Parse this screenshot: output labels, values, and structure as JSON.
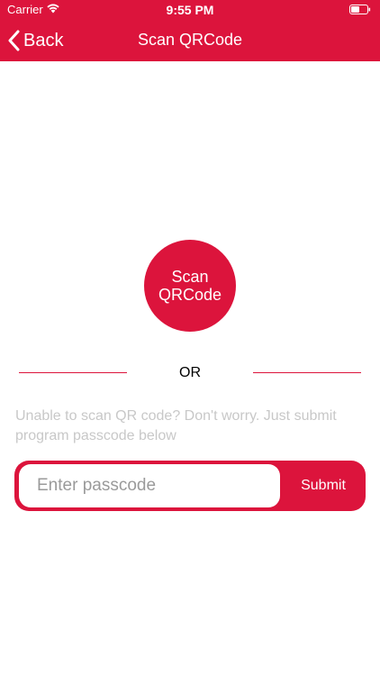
{
  "status_bar": {
    "carrier": "Carrier",
    "time": "9:55 PM",
    "wifi_icon": "wifi-icon",
    "battery_icon": "battery-icon"
  },
  "nav": {
    "back_label": "Back",
    "back_icon": "chevron-left-icon",
    "title": "Scan QRCode"
  },
  "scan_button": {
    "label": "Scan QRCode"
  },
  "divider": {
    "label": "OR"
  },
  "helper_text": "Unable to scan QR code? Don't worry. Just submit program passcode below",
  "passcode_form": {
    "input_placeholder": "Enter passcode",
    "input_value": "",
    "submit_label": "Submit"
  },
  "colors": {
    "accent": "#dc143c",
    "background": "#ffffff",
    "helper_text": "#c8c8c8"
  }
}
